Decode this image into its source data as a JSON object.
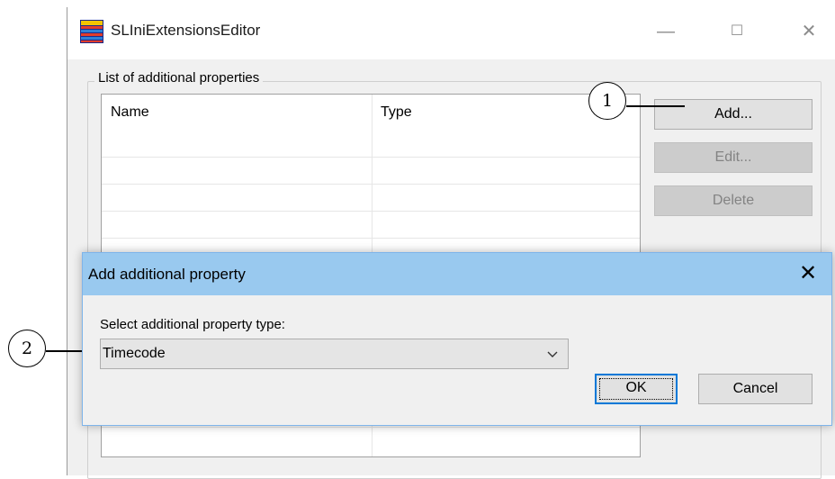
{
  "window": {
    "title": "SLIniExtensionsEditor",
    "icon": "app-icon",
    "controls": {
      "minimize": "—",
      "maximize": "☐",
      "close": "✕"
    }
  },
  "group": {
    "legend": "List of additional properties"
  },
  "list": {
    "columns": [
      "Name",
      "Type"
    ],
    "rows": []
  },
  "buttons": {
    "add": "Add...",
    "edit": "Edit...",
    "delete": "Delete"
  },
  "callouts": {
    "one": "1",
    "two": "2"
  },
  "dialog": {
    "title": "Add additional property",
    "close": "✕",
    "label": "Select additional property type:",
    "selected_type": "Timecode",
    "ok": "OK",
    "cancel": "Cancel"
  },
  "colors": {
    "dialog_titlebar": "#99c9ef",
    "dialog_border": "#7eb4ea",
    "default_button_border": "#0078d7",
    "disabled_button": "#cccccc"
  }
}
